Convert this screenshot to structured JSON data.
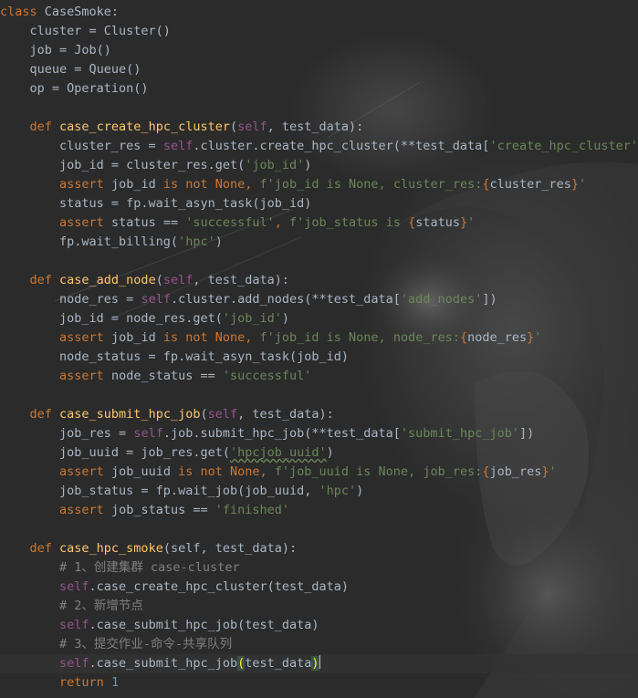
{
  "editor": {
    "lines": [
      [
        {
          "t": "class ",
          "c": "kw"
        },
        {
          "t": "CaseSmoke:",
          "c": "plain"
        }
      ],
      [
        {
          "t": "    cluster = Cluster()",
          "c": "plain"
        }
      ],
      [
        {
          "t": "    job = Job()",
          "c": "plain"
        }
      ],
      [
        {
          "t": "    queue = Queue()",
          "c": "plain"
        }
      ],
      [
        {
          "t": "    op = Operation()",
          "c": "plain"
        }
      ],
      [],
      [
        {
          "t": "    ",
          "c": "plain"
        },
        {
          "t": "def ",
          "c": "kw"
        },
        {
          "t": "case_create_hpc_cluster",
          "c": "fn"
        },
        {
          "t": "(",
          "c": "plain"
        },
        {
          "t": "self",
          "c": "self"
        },
        {
          "t": ", test_data):",
          "c": "plain"
        }
      ],
      [
        {
          "t": "        cluster_res = ",
          "c": "plain"
        },
        {
          "t": "self",
          "c": "self"
        },
        {
          "t": ".cluster.create_hpc_cluster(**test_data[",
          "c": "plain"
        },
        {
          "t": "'create_hpc_cluster'",
          "c": "str"
        },
        {
          "t": "])",
          "c": "plain"
        }
      ],
      [
        {
          "t": "        job_id = cluster_res.get(",
          "c": "plain"
        },
        {
          "t": "'job_id'",
          "c": "str"
        },
        {
          "t": ")",
          "c": "plain"
        }
      ],
      [
        {
          "t": "        ",
          "c": "plain"
        },
        {
          "t": "assert ",
          "c": "kw"
        },
        {
          "t": "job_id ",
          "c": "plain"
        },
        {
          "t": "is not None",
          "c": "kw"
        },
        {
          "t": ", ",
          "c": "kw"
        },
        {
          "t": "f'job_id is None, cluster_res:",
          "c": "str"
        },
        {
          "t": "{",
          "c": "brace"
        },
        {
          "t": "cluster_res",
          "c": "plain"
        },
        {
          "t": "}",
          "c": "brace"
        },
        {
          "t": "'",
          "c": "str"
        }
      ],
      [
        {
          "t": "        status = fp.wait_asyn_task(job_id)",
          "c": "plain"
        }
      ],
      [
        {
          "t": "        ",
          "c": "plain"
        },
        {
          "t": "assert ",
          "c": "kw"
        },
        {
          "t": "status == ",
          "c": "plain"
        },
        {
          "t": "'successful'",
          "c": "str"
        },
        {
          "t": ", ",
          "c": "kw"
        },
        {
          "t": "f'job_status is ",
          "c": "str"
        },
        {
          "t": "{",
          "c": "brace"
        },
        {
          "t": "status",
          "c": "plain"
        },
        {
          "t": "}",
          "c": "brace"
        },
        {
          "t": "'",
          "c": "str"
        }
      ],
      [
        {
          "t": "        fp.wait_billing(",
          "c": "plain"
        },
        {
          "t": "'hpc'",
          "c": "str"
        },
        {
          "t": ")",
          "c": "plain"
        }
      ],
      [],
      [
        {
          "t": "    ",
          "c": "plain"
        },
        {
          "t": "def ",
          "c": "kw"
        },
        {
          "t": "case_add_node",
          "c": "fn"
        },
        {
          "t": "(",
          "c": "plain"
        },
        {
          "t": "self",
          "c": "self"
        },
        {
          "t": ", test_data):",
          "c": "plain"
        }
      ],
      [
        {
          "t": "        node_res = ",
          "c": "plain"
        },
        {
          "t": "self",
          "c": "self"
        },
        {
          "t": ".cluster.add_nodes(**test_data[",
          "c": "plain"
        },
        {
          "t": "'add_nodes'",
          "c": "str"
        },
        {
          "t": "])",
          "c": "plain"
        }
      ],
      [
        {
          "t": "        job_id = node_res.get(",
          "c": "plain"
        },
        {
          "t": "'job_id'",
          "c": "str"
        },
        {
          "t": ")",
          "c": "plain"
        }
      ],
      [
        {
          "t": "        ",
          "c": "plain"
        },
        {
          "t": "assert ",
          "c": "kw"
        },
        {
          "t": "job_id ",
          "c": "plain"
        },
        {
          "t": "is not None",
          "c": "kw"
        },
        {
          "t": ", ",
          "c": "kw"
        },
        {
          "t": "f'job_id is None, node_res:",
          "c": "str"
        },
        {
          "t": "{",
          "c": "brace"
        },
        {
          "t": "node_res",
          "c": "plain"
        },
        {
          "t": "}",
          "c": "brace"
        },
        {
          "t": "'",
          "c": "str"
        }
      ],
      [
        {
          "t": "        node_status = fp.wait_asyn_task(job_id)",
          "c": "plain"
        }
      ],
      [
        {
          "t": "        ",
          "c": "plain"
        },
        {
          "t": "assert ",
          "c": "kw"
        },
        {
          "t": "node_status == ",
          "c": "plain"
        },
        {
          "t": "'successful'",
          "c": "str"
        }
      ],
      [],
      [
        {
          "t": "    ",
          "c": "plain"
        },
        {
          "t": "def ",
          "c": "kw"
        },
        {
          "t": "case_submit_hpc_job",
          "c": "fn"
        },
        {
          "t": "(",
          "c": "plain"
        },
        {
          "t": "self",
          "c": "self"
        },
        {
          "t": ", test_data):",
          "c": "plain"
        }
      ],
      [
        {
          "t": "        job_res = ",
          "c": "plain"
        },
        {
          "t": "self",
          "c": "self"
        },
        {
          "t": ".job.submit_hpc_job(**test_data[",
          "c": "plain"
        },
        {
          "t": "'submit_hpc_job'",
          "c": "str"
        },
        {
          "t": "])",
          "c": "plain"
        }
      ],
      [
        {
          "t": "        job_uuid = job_res.get(",
          "c": "plain"
        },
        {
          "t": "'hpcjob_uuid'",
          "c": "str squiggle"
        },
        {
          "t": ")",
          "c": "plain"
        }
      ],
      [
        {
          "t": "        ",
          "c": "plain"
        },
        {
          "t": "assert ",
          "c": "kw"
        },
        {
          "t": "job_uuid ",
          "c": "plain"
        },
        {
          "t": "is not None",
          "c": "kw"
        },
        {
          "t": ", ",
          "c": "kw"
        },
        {
          "t": "f'job_uuid is None, job_res:",
          "c": "str"
        },
        {
          "t": "{",
          "c": "brace"
        },
        {
          "t": "job_res",
          "c": "plain"
        },
        {
          "t": "}",
          "c": "brace"
        },
        {
          "t": "'",
          "c": "str"
        }
      ],
      [
        {
          "t": "        job_status = fp.wait_job(job_uuid, ",
          "c": "plain"
        },
        {
          "t": "'hpc'",
          "c": "str"
        },
        {
          "t": ")",
          "c": "plain"
        }
      ],
      [
        {
          "t": "        ",
          "c": "plain"
        },
        {
          "t": "assert ",
          "c": "kw"
        },
        {
          "t": "job_status == ",
          "c": "plain"
        },
        {
          "t": "'finished'",
          "c": "str"
        }
      ],
      [],
      [
        {
          "t": "    ",
          "c": "plain"
        },
        {
          "t": "def ",
          "c": "kw"
        },
        {
          "t": "case_hpc_smoke",
          "c": "fn"
        },
        {
          "t": "(self, test_data):",
          "c": "plain"
        }
      ],
      [
        {
          "t": "        ",
          "c": "plain"
        },
        {
          "t": "# 1、创建集群 case-cluster",
          "c": "cm"
        }
      ],
      [
        {
          "t": "        ",
          "c": "plain"
        },
        {
          "t": "self",
          "c": "self"
        },
        {
          "t": ".case_create_hpc_cluster(test_data)",
          "c": "plain"
        }
      ],
      [
        {
          "t": "        ",
          "c": "plain"
        },
        {
          "t": "# 2、新增节点",
          "c": "cm"
        }
      ],
      [
        {
          "t": "        ",
          "c": "plain"
        },
        {
          "t": "self",
          "c": "self"
        },
        {
          "t": ".case_submit_hpc_job(test_data)",
          "c": "plain"
        }
      ],
      [
        {
          "t": "        ",
          "c": "plain"
        },
        {
          "t": "# 3、提交作业-命令-共享队列",
          "c": "cm"
        }
      ],
      [
        {
          "t": "        ",
          "c": "plain"
        },
        {
          "t": "self",
          "c": "self"
        },
        {
          "t": ".case_submit_hpc_job",
          "c": "plain"
        },
        {
          "t": "(",
          "c": "paren-hl"
        },
        {
          "t": "test_data",
          "c": "plain"
        },
        {
          "t": ")",
          "c": "paren-hl"
        },
        {
          "t": "",
          "c": "caret"
        }
      ],
      [
        {
          "t": "        ",
          "c": "plain"
        },
        {
          "t": "return ",
          "c": "kw"
        },
        {
          "t": "1",
          "c": "num"
        }
      ]
    ],
    "current_line": 34
  }
}
